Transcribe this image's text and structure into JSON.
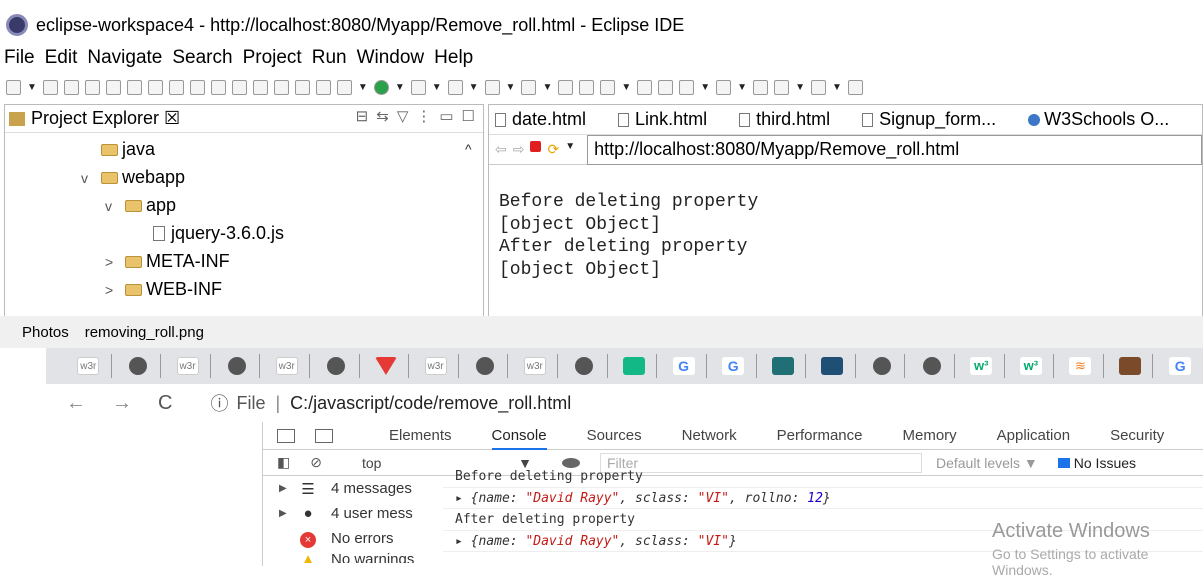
{
  "eclipse": {
    "title": "eclipse-workspace4 - http://localhost:8080/Myapp/Remove_roll.html - Eclipse IDE",
    "menu": [
      "File",
      "Edit",
      "Navigate",
      "Search",
      "Project",
      "Run",
      "Window",
      "Help"
    ],
    "explorer": {
      "title": "Project Explorer ☒",
      "items": [
        {
          "label": "java",
          "type": "folder",
          "chevron": ""
        },
        {
          "label": "webapp",
          "type": "folder",
          "chevron": "v"
        },
        {
          "label": "app",
          "type": "folder",
          "chevron": "v"
        },
        {
          "label": "jquery-3.6.0.js",
          "type": "file",
          "chevron": ""
        },
        {
          "label": "META-INF",
          "type": "folder",
          "chevron": ">"
        },
        {
          "label": "WEB-INF",
          "type": "folder",
          "chevron": ">"
        }
      ]
    },
    "tabs": [
      "date.html",
      "Link.html",
      "third.html",
      "Signup_form...",
      "W3Schools O..."
    ],
    "url": "http://localhost:8080/Myapp/Remove_roll.html",
    "output": [
      "Before deleting property",
      "[object Object]",
      "After deleting property",
      "[object Object]"
    ]
  },
  "separator": {
    "app": "Photos",
    "file": "removing_roll.png"
  },
  "chrome": {
    "address": {
      "scheme": "File",
      "path": "C:/javascript/code/remove_roll.html"
    },
    "devtools": {
      "tabs": [
        "Elements",
        "Console",
        "Sources",
        "Network",
        "Performance",
        "Memory",
        "Application",
        "Security"
      ],
      "active_tab": "Console",
      "context": "top",
      "filter_placeholder": "Filter",
      "levels": "Default levels ▼",
      "issues": "No Issues",
      "sidebar": [
        "4 messages",
        "4 user mess",
        "No errors",
        "No warnings"
      ],
      "log": [
        {
          "type": "text",
          "text": "Before deleting property"
        },
        {
          "type": "obj",
          "name": "\"David Rayy\"",
          "sclass": "\"VI\"",
          "rollno": "12"
        },
        {
          "type": "text",
          "text": "After deleting property"
        },
        {
          "type": "obj2",
          "name": "\"David Rayy\"",
          "sclass": "\"VI\""
        }
      ]
    }
  },
  "watermark": {
    "line1": "Activate Windows",
    "line2": "Go to Settings to activate Windows."
  }
}
